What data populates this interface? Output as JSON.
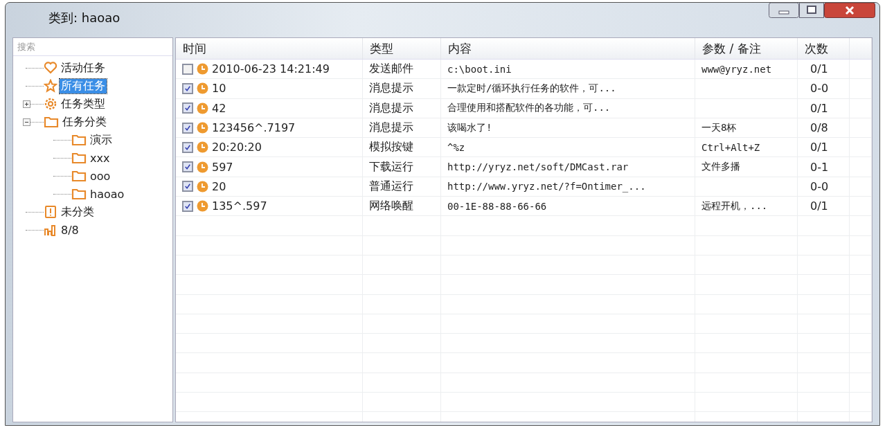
{
  "window": {
    "title": "类到: haoao"
  },
  "search": {
    "placeholder": "搜索"
  },
  "tree": [
    {
      "label": "活动任务",
      "kind": "heart",
      "selected": false
    },
    {
      "label": "所有任务",
      "kind": "star",
      "selected": true
    },
    {
      "label": "任务类型",
      "kind": "gear",
      "selected": false,
      "expanded": false
    },
    {
      "label": "任务分类",
      "kind": "folder",
      "selected": false,
      "expanded": true,
      "children": [
        {
          "label": "演示",
          "kind": "folder",
          "selected": false
        },
        {
          "label": "xxx",
          "kind": "folder",
          "selected": false
        },
        {
          "label": "ooo",
          "kind": "folder",
          "selected": false
        },
        {
          "label": "haoao",
          "kind": "folder",
          "selected": false
        }
      ]
    },
    {
      "label": "未分类",
      "kind": "alert",
      "selected": false
    },
    {
      "label": "8/8",
      "kind": "chart",
      "selected": false
    }
  ],
  "table": {
    "columns": [
      "时间",
      "类型",
      "内容",
      "参数 / 备注",
      "次数"
    ],
    "rows": [
      {
        "checked": false,
        "time": "2010-06-23 14:21:49",
        "type": "发送邮件",
        "content": "c:\\boot.ini",
        "note": "www@yryz.net",
        "count": "0/1"
      },
      {
        "checked": true,
        "time": "10",
        "type": "消息提示",
        "content": "一款定时/循环执行任务的软件，可...",
        "count": "0-0"
      },
      {
        "checked": true,
        "time": "42",
        "type": "消息提示",
        "content": "合理使用和搭配软件的各功能，可...",
        "count": "0/1"
      },
      {
        "checked": true,
        "time": "123456^.7197",
        "type": "消息提示",
        "content": "该喝水了!",
        "note": "一天8杯",
        "count": "0/8"
      },
      {
        "checked": true,
        "time": "20:20:20",
        "type": "模拟按键",
        "content": "^%z",
        "note": "Ctrl+Alt+Z",
        "count": "0/1"
      },
      {
        "checked": true,
        "time": "597",
        "type": "下载运行",
        "content": "http://yryz.net/soft/DMCast.rar",
        "note": "文件多播",
        "count": "0-1"
      },
      {
        "checked": true,
        "time": "20",
        "type": "普通运行",
        "content": "http://www.yryz.net/?f=Ontimer_...",
        "count": "0-0"
      },
      {
        "checked": true,
        "time": "135^.597",
        "type": "网络唤醒",
        "content": "00-1E-88-88-66-66",
        "note": "远程开机，...",
        "count": "0/1"
      }
    ]
  }
}
